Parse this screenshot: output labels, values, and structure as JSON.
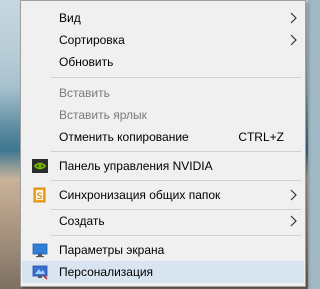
{
  "context_menu": {
    "items": [
      {
        "label": "Вид",
        "has_submenu": true
      },
      {
        "label": "Сортировка",
        "has_submenu": true
      },
      {
        "label": "Обновить"
      },
      {
        "label": "Вставить",
        "disabled": true
      },
      {
        "label": "Вставить ярлык",
        "disabled": true
      },
      {
        "label": "Отменить копирование",
        "shortcut": "CTRL+Z"
      },
      {
        "label": "Панель управления NVIDIA",
        "icon": "nvidia-icon"
      },
      {
        "label": "Синхронизация общих папок",
        "icon": "sync-folders-icon",
        "has_submenu": true
      },
      {
        "label": "Создать",
        "has_submenu": true
      },
      {
        "label": "Параметры экрана",
        "icon": "display-icon"
      },
      {
        "label": "Персонализация",
        "icon": "personalization-icon",
        "highlighted": true
      }
    ]
  },
  "colors": {
    "menu_background": "#f0f0f0",
    "hover_background": "#d8e4f0",
    "disabled_text": "#7a7a7a",
    "nvidia_green": "#76b900"
  }
}
